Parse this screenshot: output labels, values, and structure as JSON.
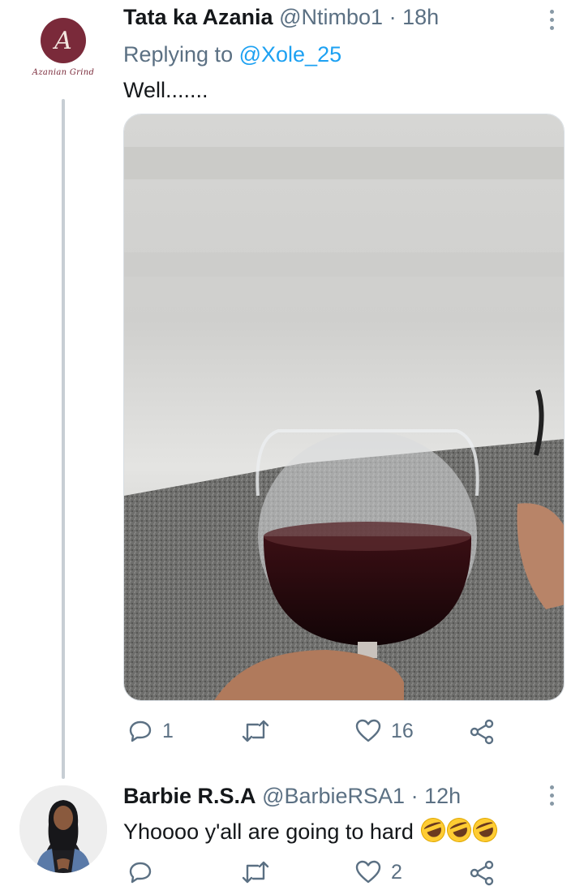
{
  "tweets": [
    {
      "author_name": "Tata ka Azania",
      "handle": "@Ntimbo1",
      "separator": "·",
      "time": "18h",
      "replying_prefix": "Replying to",
      "replying_to": "@Xole_25",
      "text": "Well.......",
      "avatar_logo_letter": "A",
      "avatar_logo_text": "Azanian Grind",
      "actions": {
        "replies": "1",
        "retweets": "",
        "likes": "16"
      }
    },
    {
      "author_name": "Barbie R.S.A",
      "handle": "@BarbieRSA1",
      "separator": "·",
      "time": "12h",
      "text": "Yhoooo y'all are going to hard",
      "emojis": [
        "rolling-on-floor-laughing",
        "rolling-on-floor-laughing",
        "rolling-on-floor-laughing"
      ],
      "actions": {
        "replies": "",
        "retweets": "",
        "likes": "2"
      }
    }
  ],
  "icons": {
    "reply": "reply-icon",
    "retweet": "retweet-icon",
    "like": "heart-icon",
    "share": "share-icon",
    "more": "more-vertical-icon"
  },
  "colors": {
    "link": "#1da1f2",
    "secondary_text": "#5b7083",
    "primary_text": "#14171a",
    "logo": "#7a2a3a"
  }
}
